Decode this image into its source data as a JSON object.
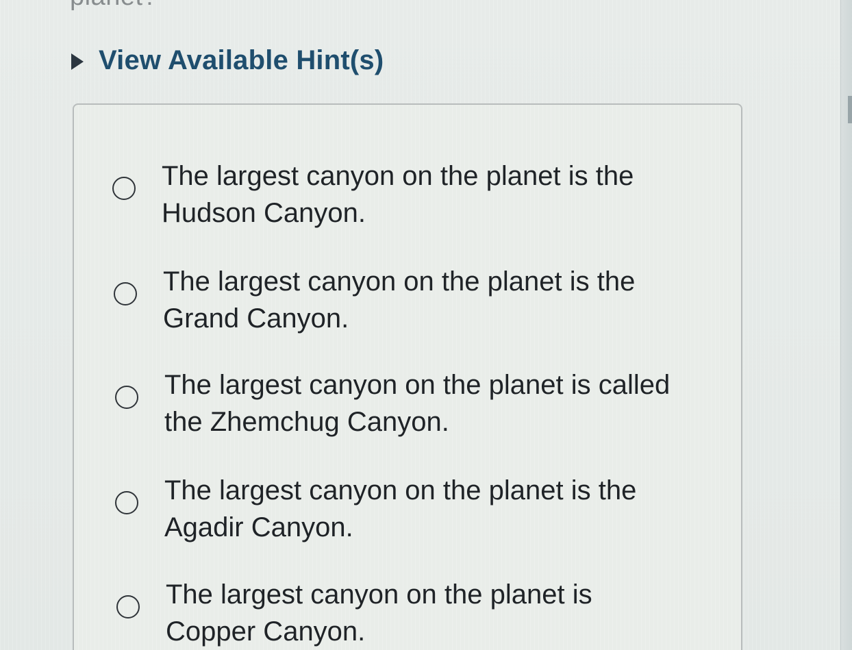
{
  "header": {
    "cutoff_text": "planet?",
    "hint_toggle_label": "View Available Hint(s)"
  },
  "question": {
    "options": [
      {
        "line1": "The largest canyon on the planet is the",
        "line2": "Hudson Canyon."
      },
      {
        "line1": "The largest canyon on the planet is the",
        "line2": "Grand Canyon."
      },
      {
        "line1": "The largest canyon on the planet is called",
        "line2": "the Zhemchug Canyon."
      },
      {
        "line1": "The largest canyon on the planet is the",
        "line2": "Agadir Canyon."
      },
      {
        "line1": "The largest canyon on the planet is",
        "line2": "Copper Canyon."
      }
    ]
  },
  "icons": {
    "hint_toggle": "caret-right-icon",
    "option_selector": "radio-button-icon"
  },
  "colors": {
    "hint_label": "#1f4e6e",
    "body_text": "#1f2327",
    "box_border": "#b8bcbc"
  }
}
